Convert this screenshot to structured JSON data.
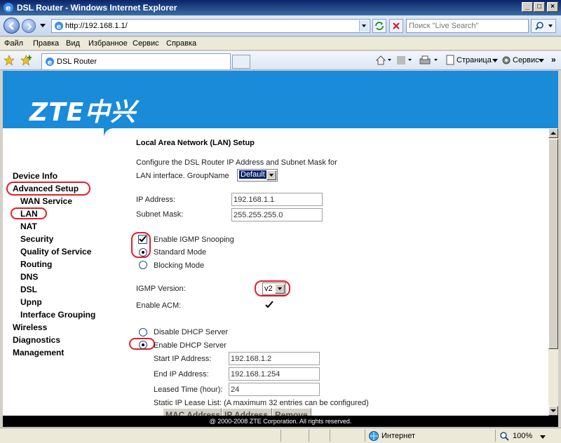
{
  "window": {
    "title": "DSL Router - Windows Internet Explorer"
  },
  "address": {
    "url": "http://192.168.1.1/"
  },
  "search": {
    "placeholder": "Поиск \"Live Search\""
  },
  "menu": [
    "Файл",
    "Правка",
    "Вид",
    "Избранное",
    "Сервис",
    "Справка"
  ],
  "tab": {
    "label": "DSL Router"
  },
  "commands": {
    "page": "Страница",
    "tools": "Сервис"
  },
  "brand": {
    "logo": "ZTE中兴"
  },
  "sidebar": {
    "items": [
      {
        "label": "Device Info",
        "level": 0
      },
      {
        "label": "Advanced Setup",
        "level": 0
      },
      {
        "label": "WAN Service",
        "level": 1
      },
      {
        "label": "LAN",
        "level": 1
      },
      {
        "label": "NAT",
        "level": 1
      },
      {
        "label": "Security",
        "level": 1
      },
      {
        "label": "Quality of Service",
        "level": 1
      },
      {
        "label": "Routing",
        "level": 1
      },
      {
        "label": "DNS",
        "level": 1
      },
      {
        "label": "DSL",
        "level": 1
      },
      {
        "label": "Upnp",
        "level": 1
      },
      {
        "label": "Interface Grouping",
        "level": 1
      },
      {
        "label": "Wireless",
        "level": 0
      },
      {
        "label": "Diagnostics",
        "level": 0
      },
      {
        "label": "Management",
        "level": 0
      }
    ]
  },
  "lan": {
    "title": "Local Area Network (LAN) Setup",
    "intro_line1": "Configure the DSL Router IP Address and Subnet Mask for",
    "intro_line2": "LAN interface.  GroupName",
    "group_value": "Default",
    "ip_label": "IP Address:",
    "ip_value": "192.168.1.1",
    "mask_label": "Subnet Mask:",
    "mask_value": "255.255.255.0",
    "igmp_snooping_label": "Enable IGMP Snooping",
    "igmp_snooping_checked": true,
    "standard_mode_label": "Standard Mode",
    "blocking_mode_label": "Blocking Mode",
    "igmp_mode": "standard",
    "igmp_version_label": "IGMP Version:",
    "igmp_version_value": "v2",
    "acm_label": "Enable ACM:",
    "acm_checked": true,
    "disable_dhcp_label": "Disable DHCP Server",
    "enable_dhcp_label": "Enable DHCP Server",
    "dhcp_mode": "enable",
    "start_ip_label": "Start IP Address:",
    "start_ip_value": "192.168.1.2",
    "end_ip_label": "End IP Address:",
    "end_ip_value": "192.168.1.254",
    "lease_label": "Leased Time (hour):",
    "lease_value": "24",
    "static_lease_label": "Static IP Lease List: (A maximum 32 entries can be configured)",
    "table_headers": [
      "MAC Address",
      "IP Address",
      "Remove"
    ]
  },
  "footer": {
    "text": "@ 2000-2008 ZTE Corporation. All rights reserved."
  },
  "status": {
    "zone": "Интернет",
    "zoom": "100%"
  },
  "colors": {
    "brand_blue": "#1a8bd8",
    "highlight_ring": "#e0202a"
  }
}
